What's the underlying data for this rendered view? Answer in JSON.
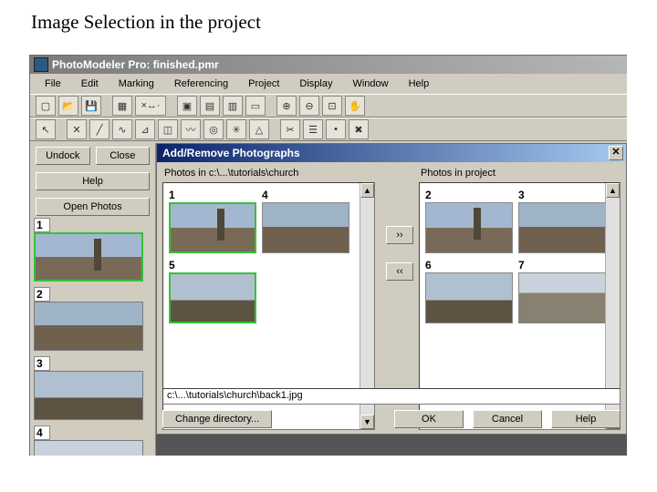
{
  "page_heading": "Image Selection in the project",
  "app_title": "PhotoModeler Pro: finished.pmr",
  "menus": [
    "File",
    "Edit",
    "Marking",
    "Referencing",
    "Project",
    "Display",
    "Window",
    "Help"
  ],
  "left_buttons": {
    "undock": "Undock",
    "close": "Close",
    "help": "Help",
    "open": "Open Photos"
  },
  "left_thumbs": [
    "1",
    "2",
    "3",
    "4"
  ],
  "dialog": {
    "title": "Add/Remove Photographs",
    "left_label": "Photos in  c:\\...\\tutorials\\church",
    "right_label": "Photos in project",
    "left_thumbs": [
      {
        "n": "1",
        "sel": true
      },
      {
        "n": "4",
        "sel": false
      },
      {
        "n": "5",
        "sel": true
      }
    ],
    "right_thumbs": [
      {
        "n": "2"
      },
      {
        "n": "3"
      },
      {
        "n": "6"
      },
      {
        "n": "7"
      }
    ],
    "move_right": "››",
    "move_left": "‹‹",
    "path": "c:\\...\\tutorials\\church\\back1.jpg",
    "change_dir": "Change directory...",
    "ok": "OK",
    "cancel": "Cancel",
    "helpb": "Help"
  }
}
